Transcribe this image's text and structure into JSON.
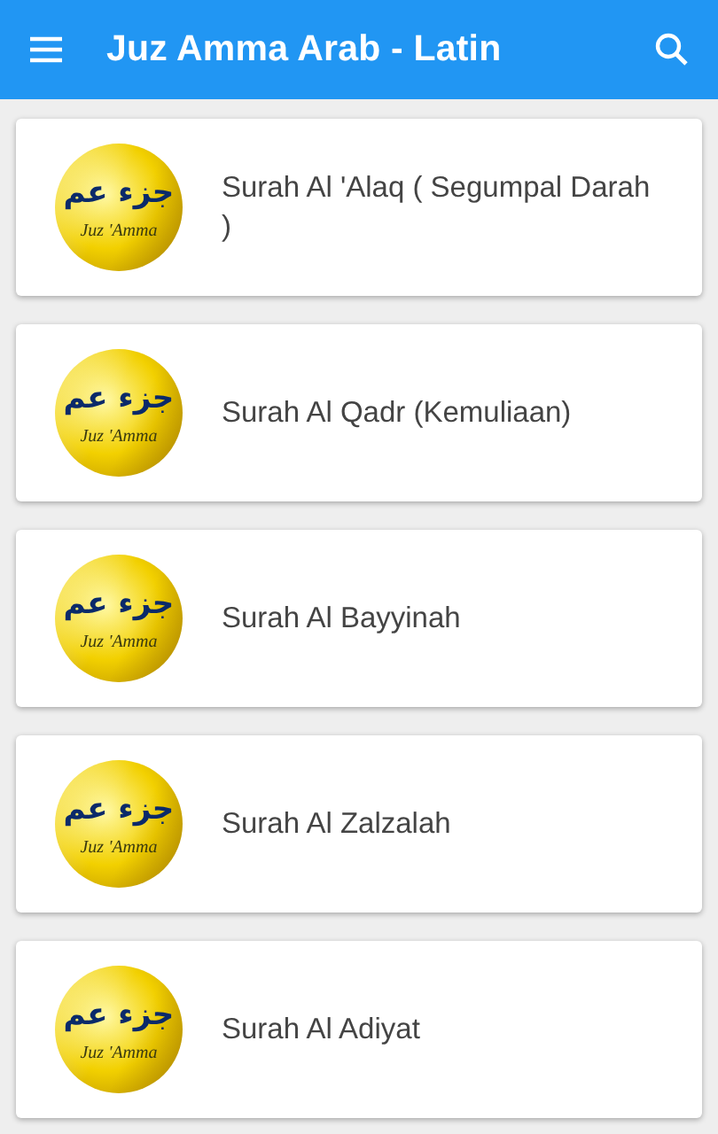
{
  "app_bar": {
    "title": "Juz Amma Arab - Latin"
  },
  "surahs": [
    {
      "title": "Surah Al 'Alaq ( Segumpal Darah )",
      "logo": {
        "arabic": "جزء عم",
        "latin": "Juz 'Amma"
      }
    },
    {
      "title": "Surah Al Qadr (Kemuliaan)",
      "logo": {
        "arabic": "جزء عم",
        "latin": "Juz 'Amma"
      }
    },
    {
      "title": "Surah Al Bayyinah",
      "logo": {
        "arabic": "جزء عم",
        "latin": "Juz 'Amma"
      }
    },
    {
      "title": "Surah Al Zalzalah",
      "logo": {
        "arabic": "جزء عم",
        "latin": "Juz 'Amma"
      }
    },
    {
      "title": "Surah Al Adiyat",
      "logo": {
        "arabic": "جزء عم",
        "latin": "Juz 'Amma"
      }
    }
  ]
}
